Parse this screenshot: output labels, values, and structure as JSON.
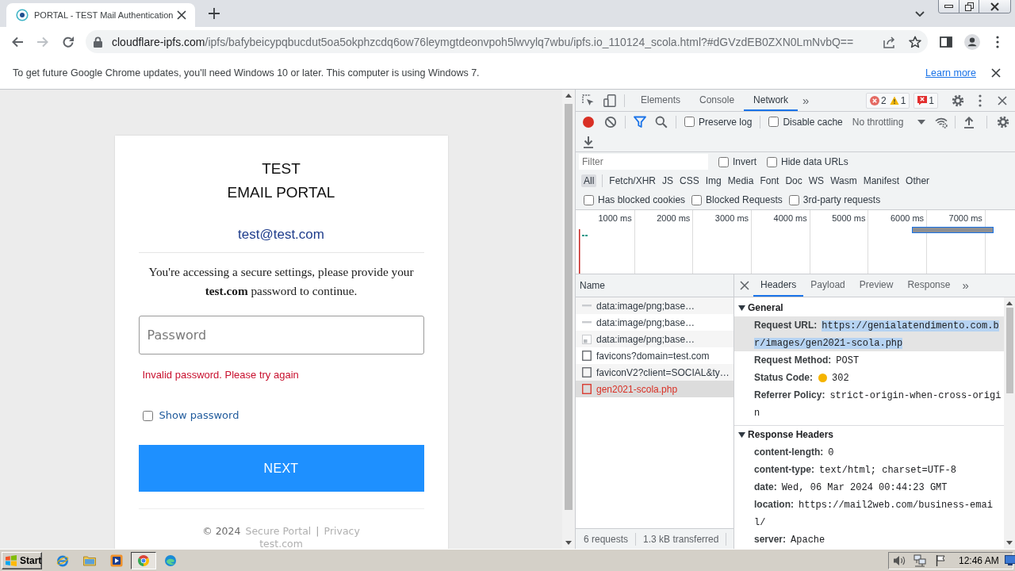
{
  "browser": {
    "tabs": [
      {
        "title": "PORTAL - TEST Mail Authentication",
        "selected": true
      }
    ],
    "address": {
      "host": "cloudflare-ipfs.com",
      "path": "/ipfs/bafybeicypqbucdut5oa5okphzcdq6ow76leymgtdeonvpoh5lwvylq7wbu/ipfs.io_110124_scola.html?#dGVzdEB0ZXN0LmNvbQ=="
    },
    "infobar": {
      "message": "To get future Google Chrome updates, you'll need Windows 10 or later. This computer is using Windows 7.",
      "link": "Learn more"
    }
  },
  "page": {
    "title_lines": [
      "TEST",
      "EMAIL PORTAL"
    ],
    "email": "test@test.com",
    "message": "You're accessing a secure settings, please provide your **test.com** password to continue.",
    "password_field": {
      "placeholder": "Password"
    },
    "error": "Invalid password. Please try again",
    "show_password": {
      "label": "Show password",
      "checked": false
    },
    "next_button": "NEXT",
    "footer": {
      "copyright": "© 2024",
      "links": [
        "Secure Portal",
        "Privacy"
      ],
      "separator": "|",
      "domain": "test.com"
    }
  },
  "devtools": {
    "tabs": [
      {
        "label": "Elements",
        "selected": false
      },
      {
        "label": "Console",
        "selected": false
      },
      {
        "label": "Network",
        "selected": true
      }
    ],
    "more_tabs": "»",
    "issue_counts": {
      "errors": "2",
      "warnings": "1",
      "issues": "1"
    },
    "toolbar": {
      "recording": true,
      "options": [
        {
          "label": "Preserve log",
          "checked": false
        },
        {
          "label": "Disable cache",
          "checked": false
        }
      ],
      "throttling": "No throttling"
    },
    "filter": {
      "placeholder": "Filter",
      "options": [
        {
          "label": "Invert",
          "checked": false
        },
        {
          "label": "Hide data URLs",
          "checked": false
        }
      ]
    },
    "types": [
      {
        "label": "All",
        "selected": true
      },
      {
        "label": "Fetch/XHR",
        "selected": false
      },
      {
        "label": "JS",
        "selected": false
      },
      {
        "label": "CSS",
        "selected": false
      },
      {
        "label": "Img",
        "selected": false
      },
      {
        "label": "Media",
        "selected": false
      },
      {
        "label": "Font",
        "selected": false
      },
      {
        "label": "Doc",
        "selected": false
      },
      {
        "label": "WS",
        "selected": false
      },
      {
        "label": "Wasm",
        "selected": false
      },
      {
        "label": "Manifest",
        "selected": false
      },
      {
        "label": "Other",
        "selected": false
      }
    ],
    "flags": [
      {
        "label": "Has blocked cookies",
        "checked": false
      },
      {
        "label": "Blocked Requests",
        "checked": false
      },
      {
        "label": "3rd-party requests",
        "checked": false
      }
    ],
    "timeline": {
      "ticks": [
        "1000 ms",
        "2000 ms",
        "3000 ms",
        "4000 ms",
        "5000 ms",
        "6000 ms",
        "7000 ms"
      ]
    },
    "requests": {
      "heading": "Name",
      "rows": [
        {
          "name": "data:image/png;base…",
          "kind": "preview",
          "failed": false,
          "selected": false
        },
        {
          "name": "data:image/png;base…",
          "kind": "preview",
          "failed": false,
          "selected": false
        },
        {
          "name": "data:image/png;base…",
          "kind": "image",
          "failed": false,
          "selected": false
        },
        {
          "name": "favicons?domain=test.com",
          "kind": "document",
          "failed": false,
          "selected": false
        },
        {
          "name": "faviconV2?client=SOCIAL&ty…",
          "kind": "document",
          "failed": false,
          "selected": false
        },
        {
          "name": "gen2021-scola.php",
          "kind": "document",
          "failed": true,
          "selected": true
        }
      ],
      "summary": [
        "6 requests",
        "1.3 kB transferred"
      ]
    },
    "details": {
      "tabs": [
        {
          "label": "Headers",
          "selected": true
        },
        {
          "label": "Payload",
          "selected": false
        },
        {
          "label": "Preview",
          "selected": false
        },
        {
          "label": "Response",
          "selected": false
        }
      ],
      "more_tabs": "»",
      "sections": [
        {
          "title": "General",
          "expanded": true,
          "items": [
            {
              "name": "Request URL:",
              "value": "https://genialatendimento.com.br/images/gen2021-scola.php",
              "kind": "text",
              "selected": true
            },
            {
              "name": "Request Method:",
              "value": "POST",
              "kind": "text",
              "selected": false
            },
            {
              "name": "Status Code:",
              "value": "302",
              "kind": "status",
              "selected": false
            },
            {
              "name": "Referrer Policy:",
              "value": "strict-origin-when-cross-origin",
              "kind": "text",
              "selected": false
            }
          ]
        },
        {
          "title": "Response Headers",
          "expanded": true,
          "items": [
            {
              "name": "content-length:",
              "value": "0",
              "selected": false
            },
            {
              "name": "content-type:",
              "value": "text/html; charset=UTF-8",
              "selected": false
            },
            {
              "name": "date:",
              "value": "Wed, 06 Mar 2024 00:44:23 GMT",
              "selected": false
            },
            {
              "name": "location:",
              "value": "https://mail2web.com/business-email/",
              "selected": false
            },
            {
              "name": "server:",
              "value": "Apache",
              "selected": false
            }
          ]
        }
      ]
    }
  },
  "taskbar": {
    "start": "Start",
    "apps": [
      {
        "kind": "browser-e",
        "active": false
      },
      {
        "kind": "folder",
        "active": false
      },
      {
        "kind": "player",
        "active": false
      },
      {
        "kind": "browser-round",
        "active": true
      },
      {
        "kind": "browser-wave",
        "active": false
      }
    ],
    "clock": "12:46 AM"
  }
}
